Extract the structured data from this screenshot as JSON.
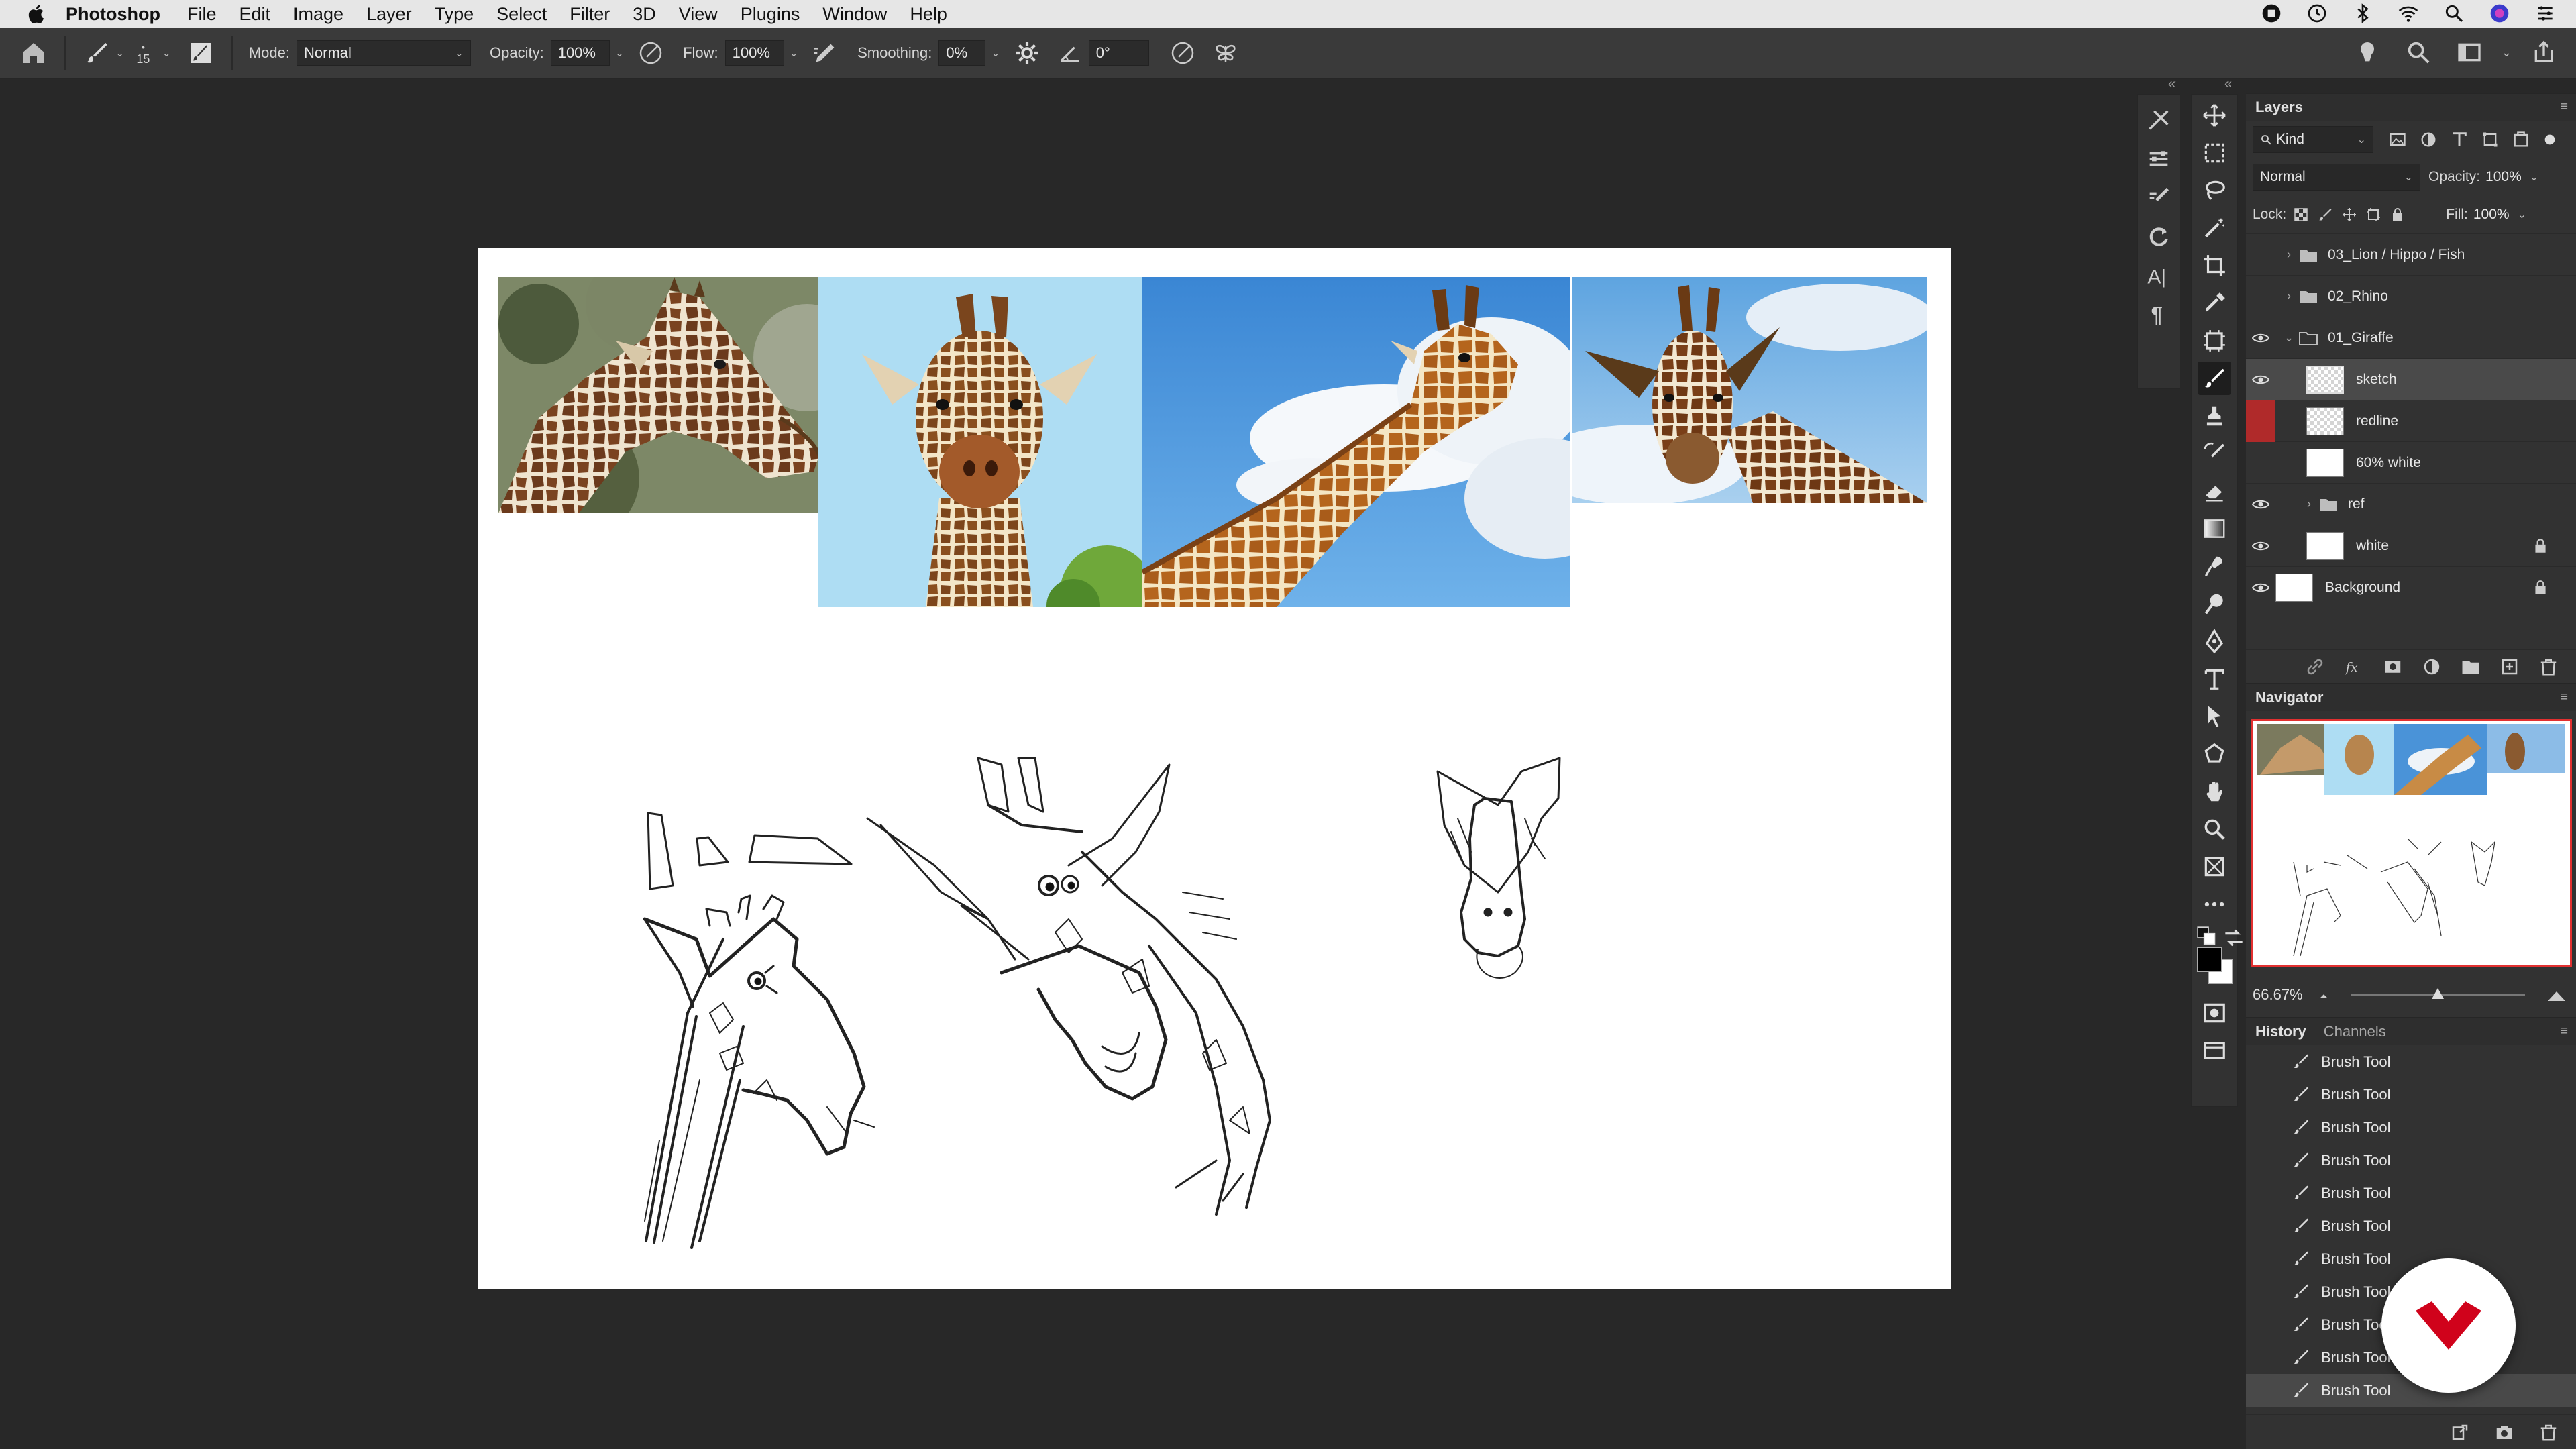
{
  "menubar": {
    "app_name": "Photoshop",
    "items": [
      "File",
      "Edit",
      "Image",
      "Layer",
      "Type",
      "Select",
      "Filter",
      "3D",
      "View",
      "Plugins",
      "Window",
      "Help"
    ]
  },
  "options_bar": {
    "brush_size": "15",
    "mode_label": "Mode:",
    "mode_value": "Normal",
    "opacity_label": "Opacity:",
    "opacity_value": "100%",
    "flow_label": "Flow:",
    "flow_value": "100%",
    "smoothing_label": "Smoothing:",
    "smoothing_value": "0%",
    "angle_value": "0°"
  },
  "layers_panel": {
    "title": "Layers",
    "filter_value": "Kind",
    "blend_mode": "Normal",
    "opacity_label": "Opacity:",
    "opacity_value": "100%",
    "lock_label": "Lock:",
    "fill_label": "Fill:",
    "fill_value": "100%",
    "layers": [
      {
        "name": "03_Lion / Hippo / Fish",
        "type": "group",
        "visible": false,
        "collapsed": true
      },
      {
        "name": "02_Rhino",
        "type": "group",
        "visible": false,
        "collapsed": true
      },
      {
        "name": "01_Giraffe",
        "type": "group",
        "visible": true,
        "collapsed": false
      },
      {
        "name": "sketch",
        "type": "layer",
        "visible": true,
        "selected": true
      },
      {
        "name": "redline",
        "type": "layer",
        "visible": false,
        "color_tag": "#b02a2a"
      },
      {
        "name": "60% white",
        "type": "layer",
        "visible": false
      },
      {
        "name": "ref",
        "type": "group",
        "visible": true,
        "collapsed": true
      },
      {
        "name": "white",
        "type": "layer",
        "visible": true,
        "locked": true
      },
      {
        "name": "Background",
        "type": "layer",
        "visible": true,
        "locked": true
      }
    ]
  },
  "navigator_panel": {
    "title": "Navigator",
    "zoom": "66.67%",
    "zoom_fraction": 0.5
  },
  "history_panel": {
    "tabs": [
      "History",
      "Channels"
    ],
    "items": [
      "Brush Tool",
      "Brush Tool",
      "Brush Tool",
      "Brush Tool",
      "Brush Tool",
      "Brush Tool",
      "Brush Tool",
      "Brush Tool",
      "Brush Tool",
      "Brush Tool",
      "Brush Tool"
    ]
  },
  "colors": {
    "foreground": "#000000",
    "background": "#ffffff",
    "accent_red": "#e23030",
    "brand": "#d0021b"
  }
}
